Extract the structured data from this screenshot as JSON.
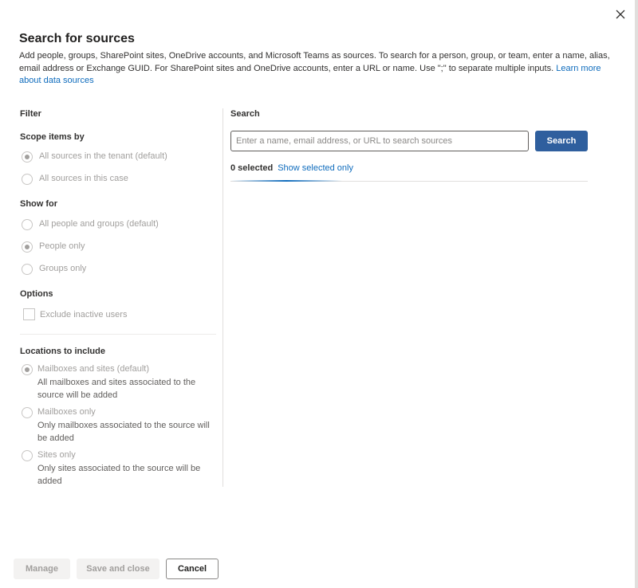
{
  "dialog": {
    "title": "Search for sources",
    "description": "Add people, groups, SharePoint sites, OneDrive accounts, and Microsoft Teams as sources. To search for a person, group, or team, enter a name, alias, email address or Exchange GUID. For SharePoint sites and OneDrive accounts, enter a URL or name. Use \";\" to separate multiple inputs.",
    "learn_more": "Learn more about data sources",
    "close_icon": "close-icon"
  },
  "filter": {
    "title": "Filter",
    "scope": {
      "label": "Scope items by",
      "options": [
        "All sources in the tenant (default)",
        "All sources in this case"
      ],
      "selected": 0
    },
    "show_for": {
      "label": "Show for",
      "options": [
        "All people and groups (default)",
        "People only",
        "Groups only"
      ],
      "selected": 1
    },
    "options": {
      "label": "Options",
      "exclude_inactive": "Exclude inactive users",
      "exclude_inactive_checked": false
    },
    "locations": {
      "label": "Locations to include",
      "options": [
        {
          "label": "Mailboxes and sites (default)",
          "sub": "All mailboxes and sites associated to the source will be added"
        },
        {
          "label": "Mailboxes only",
          "sub": "Only mailboxes associated to the source will be added"
        },
        {
          "label": "Sites only",
          "sub": "Only sites associated to the source will be added"
        }
      ],
      "selected": 0
    }
  },
  "search": {
    "title": "Search",
    "placeholder": "Enter a name, email address, or URL to search sources",
    "value": "",
    "button": "Search",
    "selected_count": "0 selected",
    "show_selected": "Show selected only"
  },
  "footer": {
    "manage": "Manage",
    "save_close": "Save and close",
    "cancel": "Cancel"
  },
  "colors": {
    "accent": "#0f6cbd",
    "search_button": "#2f5f9e"
  }
}
